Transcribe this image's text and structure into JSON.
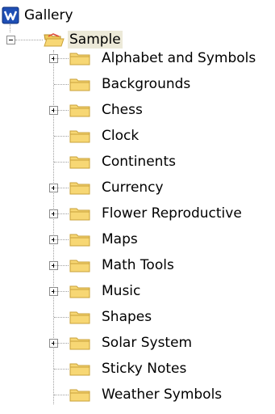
{
  "root": {
    "label": "Gallery",
    "icon": "gallery-app-icon"
  },
  "sample": {
    "label": "Sample",
    "icon": "open-folder-icon",
    "expanded": true,
    "selected": true
  },
  "items": [
    {
      "label": "Alphabet and Symbols",
      "expandable": true
    },
    {
      "label": "Backgrounds",
      "expandable": false
    },
    {
      "label": "Chess",
      "expandable": true
    },
    {
      "label": "Clock",
      "expandable": false
    },
    {
      "label": "Continents",
      "expandable": false
    },
    {
      "label": "Currency",
      "expandable": true
    },
    {
      "label": "Flower Reproductive",
      "expandable": true
    },
    {
      "label": "Maps",
      "expandable": true
    },
    {
      "label": "Math Tools",
      "expandable": true
    },
    {
      "label": "Music",
      "expandable": true
    },
    {
      "label": "Shapes",
      "expandable": false
    },
    {
      "label": "Solar System",
      "expandable": true
    },
    {
      "label": "Sticky Notes",
      "expandable": false
    },
    {
      "label": "Weather Symbols",
      "expandable": false
    }
  ],
  "colors": {
    "folder": "#f7d774",
    "folder_edge": "#c9a23a",
    "selection": "#ece9d8",
    "tree_line": "#a0a0a0",
    "app_icon": "#1f4fb5"
  }
}
